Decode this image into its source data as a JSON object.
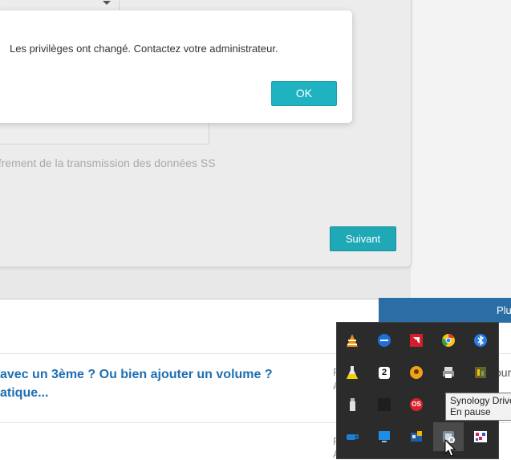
{
  "dialog": {
    "message": "Les privilèges ont changé. Contactez votre administrateur.",
    "ok_label": "OK"
  },
  "wizard": {
    "ssl_label": "iffrement de la transmission des données SS",
    "next_label": "Suivant"
  },
  "forum": {
    "plus_label": "Plu",
    "thread_title_line1": "avec un 3ème ? Ou bien ajouter un volume ?",
    "thread_title_line2": "atique...",
    "col_p": "F",
    "col_a": "A",
    "col_r": "our"
  },
  "tray": {
    "icons": [
      "vlc-icon",
      "onenote-sync-icon",
      "amd-icon",
      "chrome-icon",
      "bluetooth-icon",
      "lab-flask-icon",
      "calendar-icon",
      "location-icon",
      "printer-icon",
      "app-monitor-icon",
      "usb-icon",
      "blank-app-icon",
      "os-app-icon",
      "green-app-icon",
      "green-app-icon",
      "teams-cup-icon",
      "display-icon",
      "network-app-icon",
      "synology-drive-icon",
      "puzzle-icon"
    ],
    "calendar_text": "2",
    "os_text": "OS"
  },
  "tooltip": {
    "line1": "Synology Drive",
    "line2": "En pause"
  }
}
